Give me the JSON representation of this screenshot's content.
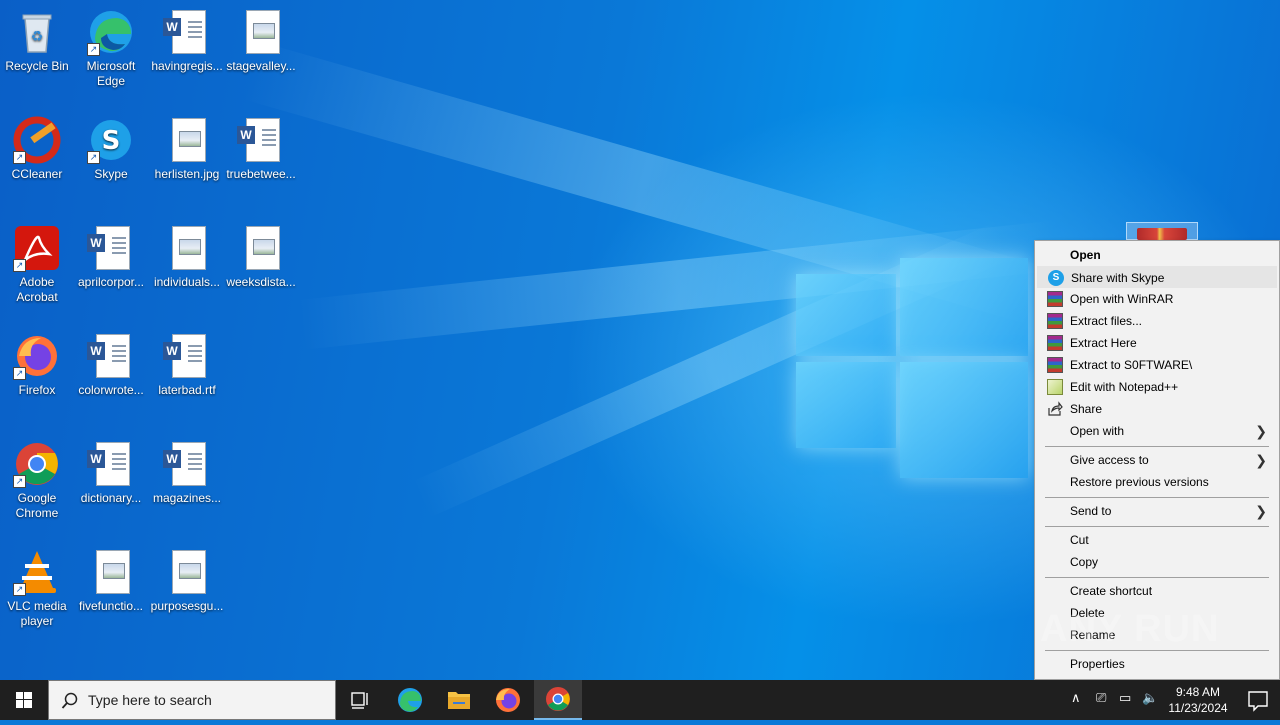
{
  "desktop": {
    "icons": [
      {
        "label": "Recycle Bin",
        "icon": "recycle-bin-icon"
      },
      {
        "label": "Microsoft Edge",
        "icon": "edge-icon"
      },
      {
        "label": "havingregis...",
        "icon": "word-document-icon"
      },
      {
        "label": "stagevalley...",
        "icon": "image-file-icon"
      },
      {
        "label": "CCleaner",
        "icon": "ccleaner-icon"
      },
      {
        "label": "Skype",
        "icon": "skype-icon"
      },
      {
        "label": "herlisten.jpg",
        "icon": "image-file-icon"
      },
      {
        "label": "truebetwee...",
        "icon": "word-document-icon"
      },
      {
        "label": "Adobe Acrobat",
        "icon": "acrobat-icon"
      },
      {
        "label": "aprilcorpor...",
        "icon": "word-document-icon"
      },
      {
        "label": "individuals...",
        "icon": "image-file-icon"
      },
      {
        "label": "weeksdista...",
        "icon": "image-file-icon"
      },
      {
        "label": "Firefox",
        "icon": "firefox-icon"
      },
      {
        "label": "colorwrote...",
        "icon": "word-document-icon"
      },
      {
        "label": "laterbad.rtf",
        "icon": "word-document-icon"
      },
      {
        "label": "Google Chrome",
        "icon": "chrome-icon"
      },
      {
        "label": "dictionary...",
        "icon": "word-document-icon"
      },
      {
        "label": "magazines...",
        "icon": "word-document-icon"
      },
      {
        "label": "VLC media player",
        "icon": "vlc-icon"
      },
      {
        "label": "fivefunctio...",
        "icon": "image-file-icon"
      },
      {
        "label": "purposesgu...",
        "icon": "image-file-icon"
      }
    ]
  },
  "context_menu": {
    "items": [
      {
        "label": "Open",
        "bold": true
      },
      {
        "label": "Share with Skype",
        "icon": "skype-icon",
        "highlighted": true
      },
      {
        "label": "Open with WinRAR",
        "icon": "winrar-icon"
      },
      {
        "label": "Extract files...",
        "icon": "winrar-icon"
      },
      {
        "label": "Extract Here",
        "icon": "winrar-icon"
      },
      {
        "label": "Extract to S0FTWARE\\",
        "icon": "winrar-icon"
      },
      {
        "label": "Edit with Notepad++",
        "icon": "notepadpp-icon"
      },
      {
        "label": "Share",
        "icon": "share-icon"
      },
      {
        "label": "Open with",
        "submenu": true
      },
      {
        "label": "Give access to",
        "submenu": true
      },
      {
        "label": "Restore previous versions"
      },
      {
        "label": "Send to",
        "submenu": true
      },
      {
        "label": "Cut"
      },
      {
        "label": "Copy"
      },
      {
        "label": "Create shortcut"
      },
      {
        "label": "Delete"
      },
      {
        "label": "Rename"
      },
      {
        "label": "Properties"
      }
    ]
  },
  "taskbar": {
    "search_placeholder": "Type here to search",
    "pinned": [
      "task-view-icon",
      "edge-icon",
      "file-explorer-icon",
      "firefox-icon",
      "chrome-icon"
    ],
    "clock": {
      "time": "9:48 AM",
      "date": "11/23/2024"
    }
  },
  "watermark": "ANY RUN",
  "colors": {
    "desktop": "#0a78d7",
    "taskbar": "#1f1f1f",
    "menu_bg": "#f2f2f2",
    "menu_highlight": "#e5e5e5"
  }
}
